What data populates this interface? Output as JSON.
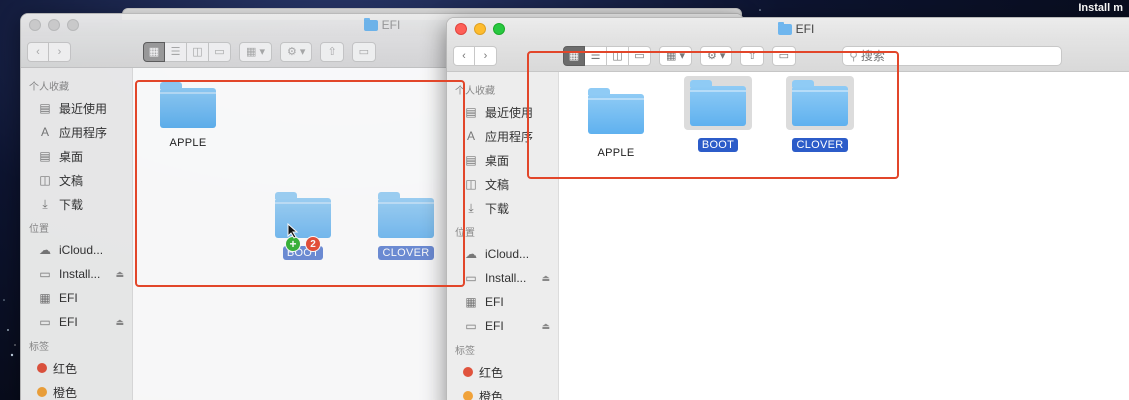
{
  "desktop": {
    "menubar_text": "Install m"
  },
  "back_window": {
    "title": "EFI",
    "sidebar": {
      "favorites_title": "个人收藏",
      "favorites": [
        {
          "label": "最近使用",
          "icon": "clock-icon"
        },
        {
          "label": "应用程序",
          "icon": "applications-icon"
        },
        {
          "label": "桌面",
          "icon": "desktop-icon"
        },
        {
          "label": "文稿",
          "icon": "document-icon"
        },
        {
          "label": "下载",
          "icon": "download-icon"
        }
      ],
      "locations_title": "位置",
      "locations": [
        {
          "label": "iCloud...",
          "icon": "cloud-icon"
        },
        {
          "label": "Install...",
          "icon": "disk-icon",
          "eject": true
        },
        {
          "label": "EFI",
          "icon": "disk-icon"
        },
        {
          "label": "EFI",
          "icon": "disk-icon",
          "eject": true
        }
      ],
      "tags_title": "标签",
      "tags": [
        {
          "label": "红色",
          "color": "#e0533d"
        },
        {
          "label": "橙色",
          "color": "#f0a23a"
        }
      ]
    },
    "folders": [
      {
        "label": "APPLE"
      },
      {
        "label": "BOOT",
        "drag_count": "2",
        "plus": "+"
      },
      {
        "label": "CLOVER"
      }
    ]
  },
  "front_window": {
    "title": "EFI",
    "search_placeholder": "搜索",
    "sidebar": {
      "favorites_title": "个人收藏",
      "favorites": [
        {
          "label": "最近使用",
          "icon": "clock-icon"
        },
        {
          "label": "应用程序",
          "icon": "applications-icon"
        },
        {
          "label": "桌面",
          "icon": "desktop-icon"
        },
        {
          "label": "文稿",
          "icon": "document-icon"
        },
        {
          "label": "下载",
          "icon": "download-icon"
        }
      ],
      "locations_title": "位置",
      "locations": [
        {
          "label": "iCloud...",
          "icon": "cloud-icon"
        },
        {
          "label": "Install...",
          "icon": "disk-icon",
          "eject": true
        },
        {
          "label": "EFI",
          "icon": "disk-icon"
        },
        {
          "label": "EFI",
          "icon": "disk-icon",
          "eject": true
        }
      ],
      "tags_title": "标签",
      "tags": [
        {
          "label": "红色",
          "color": "#e0533d"
        },
        {
          "label": "橙色",
          "color": "#f0a23a"
        }
      ]
    },
    "folders": [
      {
        "label": "APPLE"
      },
      {
        "label": "BOOT"
      },
      {
        "label": "CLOVER"
      }
    ]
  },
  "colors": {
    "highlight": "#e2462a",
    "selection": "#2c5cc9",
    "folder": "#6fb6ee"
  }
}
